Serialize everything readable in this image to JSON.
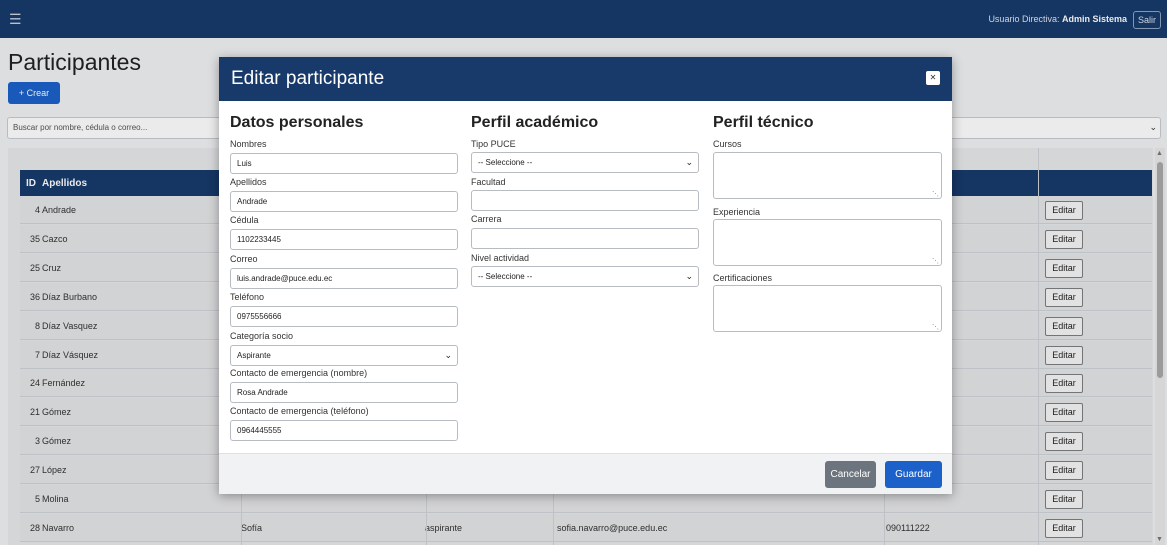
{
  "topbar": {
    "menu_icon": "hamburger-icon",
    "user_prefix": "Usuario Directiva: ",
    "user_name": "Admin Sistema",
    "logout_label": "Salir"
  },
  "page": {
    "title": "Participantes",
    "create_label": "+ Crear",
    "search_placeholder": "Buscar por nombre, cédula o correo..."
  },
  "table": {
    "headers": {
      "id": "ID",
      "apellidos": "Apellidos"
    },
    "edit_label": "Editar",
    "rows": [
      {
        "id": "4",
        "apellidos": "Andrade",
        "nombres": "",
        "categoria": "",
        "correo": "",
        "telefono": ""
      },
      {
        "id": "35",
        "apellidos": "Cazco",
        "nombres": "",
        "categoria": "",
        "correo": "",
        "telefono": ""
      },
      {
        "id": "25",
        "apellidos": "Cruz",
        "nombres": "",
        "categoria": "",
        "correo": "",
        "telefono": ""
      },
      {
        "id": "36",
        "apellidos": "Díaz Burbano",
        "nombres": "",
        "categoria": "",
        "correo": "",
        "telefono": ""
      },
      {
        "id": "8",
        "apellidos": "Díaz Vasquez",
        "nombres": "",
        "categoria": "",
        "correo": "",
        "telefono": ""
      },
      {
        "id": "7",
        "apellidos": "Díaz Vásquez",
        "nombres": "",
        "categoria": "",
        "correo": "",
        "telefono": ""
      },
      {
        "id": "24",
        "apellidos": "Fernández",
        "nombres": "",
        "categoria": "",
        "correo": "",
        "telefono": ""
      },
      {
        "id": "21",
        "apellidos": "Gómez",
        "nombres": "",
        "categoria": "",
        "correo": "",
        "telefono": ""
      },
      {
        "id": "3",
        "apellidos": "Gómez",
        "nombres": "",
        "categoria": "",
        "correo": "",
        "telefono": ""
      },
      {
        "id": "27",
        "apellidos": "López",
        "nombres": "",
        "categoria": "",
        "correo": "",
        "telefono": ""
      },
      {
        "id": "5",
        "apellidos": "Molina",
        "nombres": "",
        "categoria": "",
        "correo": "",
        "telefono": ""
      },
      {
        "id": "28",
        "apellidos": "Navarro",
        "nombres": "Sofía",
        "categoria": "aspirante",
        "correo": "sofia.navarro@puce.edu.ec",
        "telefono": "090111222"
      }
    ]
  },
  "modal": {
    "title": "Editar participante",
    "close_icon": "close-icon",
    "personal": {
      "title": "Datos personales",
      "nombres_label": "Nombres",
      "nombres_value": "Luis",
      "apellidos_label": "Apellidos",
      "apellidos_value": "Andrade",
      "cedula_label": "Cédula",
      "cedula_value": "1102233445",
      "correo_label": "Correo",
      "correo_value": "luis.andrade@puce.edu.ec",
      "telefono_label": "Teléfono",
      "telefono_value": "0975556666",
      "categoria_label": "Categoría socio",
      "categoria_value": "Aspirante",
      "emerg_nombre_label": "Contacto de emergencia (nombre)",
      "emerg_nombre_value": "Rosa Andrade",
      "emerg_tel_label": "Contacto de emergencia (teléfono)",
      "emerg_tel_value": "0964445555"
    },
    "academic": {
      "title": "Perfil académico",
      "tipo_label": "Tipo PUCE",
      "tipo_value": "-- Seleccione --",
      "facultad_label": "Facultad",
      "facultad_value": "",
      "carrera_label": "Carrera",
      "carrera_value": "",
      "nivel_label": "Nivel actividad",
      "nivel_value": "-- Seleccione --"
    },
    "technical": {
      "title": "Perfil técnico",
      "cursos_label": "Cursos",
      "experiencia_label": "Experiencia",
      "certificaciones_label": "Certificaciones"
    },
    "cancel_label": "Cancelar",
    "save_label": "Guardar"
  }
}
